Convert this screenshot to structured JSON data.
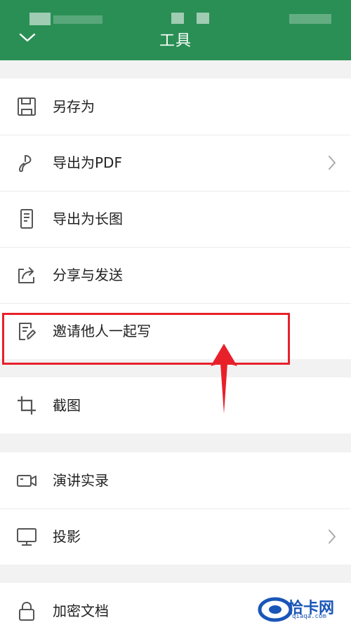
{
  "header": {
    "title": "工具",
    "background": "#2a8f55",
    "collapse_icon": "chevron-down-icon"
  },
  "groups": [
    {
      "items": [
        {
          "label": "另存为",
          "icon": "save-icon"
        },
        {
          "label": "导出为PDF",
          "icon": "pdf-export-icon",
          "has_chevron": true
        },
        {
          "label": "导出为长图",
          "icon": "long-image-icon"
        },
        {
          "label": "分享与发送",
          "icon": "share-icon"
        },
        {
          "label": "邀请他人一起写",
          "icon": "invite-edit-icon",
          "highlighted": true
        }
      ]
    },
    {
      "items": [
        {
          "label": "截图",
          "icon": "crop-icon"
        }
      ]
    },
    {
      "items": [
        {
          "label": "演讲实录",
          "icon": "video-record-icon"
        },
        {
          "label": "投影",
          "icon": "projection-icon",
          "has_chevron": true
        }
      ]
    },
    {
      "items": [
        {
          "label": "加密文档",
          "icon": "lock-icon"
        }
      ]
    }
  ],
  "annotation": {
    "highlight_color": "#e8202a"
  },
  "watermark": {
    "text": "恰卡网",
    "url": "qiaqa.com"
  }
}
